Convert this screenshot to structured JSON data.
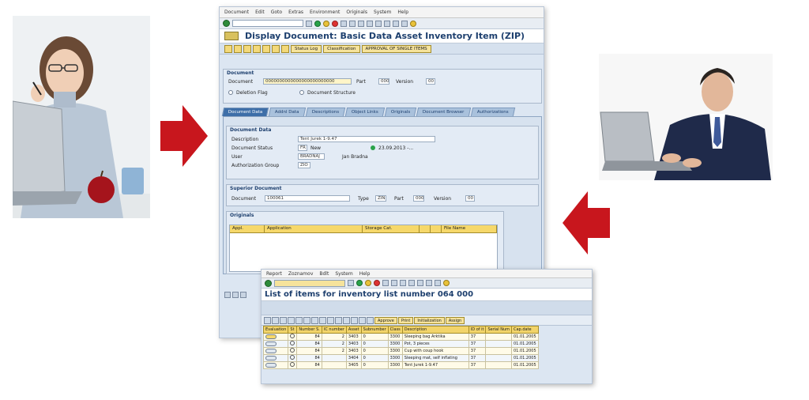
{
  "main_window": {
    "menu": [
      "Document",
      "Edit",
      "Goto",
      "Extras",
      "Environment",
      "Originals",
      "System",
      "Help"
    ],
    "title": "Display Document: Basic Data Asset Inventory Item (ZIP)",
    "toolbar_buttons": [
      "Status Log",
      "Classification",
      "APPROVAL OF SINGLE ITEMS"
    ],
    "document_group": {
      "title": "Document",
      "document_label": "Document",
      "document_value": "0000000000000000000000000",
      "part_label": "Part",
      "part_value": "000",
      "version_label": "Version",
      "version_value": "00",
      "deletion_flag": "Deletion Flag",
      "document_structure": "Document Structure"
    },
    "tabs": [
      "Document Data",
      "Addnl Data",
      "Descriptions",
      "Object Links",
      "Originals",
      "Document Browser",
      "Authorizations"
    ],
    "document_data": {
      "title": "Document Data",
      "description_label": "Description",
      "description_value": "Tent Jurek 1-9.47",
      "status_label": "Document Status",
      "status_code": "FR",
      "status_text": "New",
      "status_date": "23.09.2013 -...",
      "user_label": "User",
      "user_value": "BRADNAJ",
      "user_name": "Jan Bradna",
      "auth_label": "Authorization Group",
      "auth_value": "ZIO"
    },
    "superior": {
      "title": "Superior Document",
      "document_label": "Document",
      "document_value": "100061",
      "type_label": "Type",
      "type_value": "ZIN",
      "part_label": "Part",
      "part_value": "000",
      "version_label": "Version",
      "version_value": "00"
    },
    "originals": {
      "title": "Originals",
      "columns": [
        "Appl.",
        "Application",
        "Storage Cat.",
        "",
        "",
        "File Name"
      ]
    }
  },
  "list_window": {
    "menu": [
      "Report",
      "Zoznamov",
      "Bdlt",
      "System",
      "Help"
    ],
    "title": "List of items for inventory list number 064 000",
    "toolbar_buttons": [
      "Approve",
      "Print",
      "Initialization",
      "Assign"
    ],
    "columns": [
      "Evaluation",
      "St",
      "Number S.",
      "IC number",
      "Asset",
      "Subnumber",
      "Class",
      "Description",
      "ID of it",
      "Serial Num",
      "Cap.date"
    ],
    "rows": [
      {
        "st": "",
        "num": "84",
        "ic": "2",
        "asset": "3403",
        "sub": "0",
        "class": "3300",
        "desc": "Sleeping bag Arktika",
        "id": "37",
        "serial": "",
        "cap": "01.01.2005"
      },
      {
        "st": "",
        "num": "84",
        "ic": "2",
        "asset": "3403",
        "sub": "0",
        "class": "3300",
        "desc": "Pot, 3 pieces",
        "id": "37",
        "serial": "",
        "cap": "01.01.2005"
      },
      {
        "st": "",
        "num": "84",
        "ic": "2",
        "asset": "3403",
        "sub": "0",
        "class": "3300",
        "desc": "Cup with coup hook",
        "id": "37",
        "serial": "",
        "cap": "01.01.2005"
      },
      {
        "st": "",
        "num": "84",
        "ic": "",
        "asset": "3404",
        "sub": "0",
        "class": "3300",
        "desc": "Sleeping mat, self inflating",
        "id": "37",
        "serial": "",
        "cap": "01.01.2005"
      },
      {
        "st": "",
        "num": "84",
        "ic": "",
        "asset": "3405",
        "sub": "0",
        "class": "3300",
        "desc": "Tent Jurek 1-9.47",
        "id": "37",
        "serial": "",
        "cap": "01.01.2005"
      }
    ]
  },
  "colors": {
    "arrow": "#c8161d",
    "sap_bg": "#dce6f2",
    "title_text": "#1d3f6e",
    "header_yellow": "#f2d46a"
  }
}
